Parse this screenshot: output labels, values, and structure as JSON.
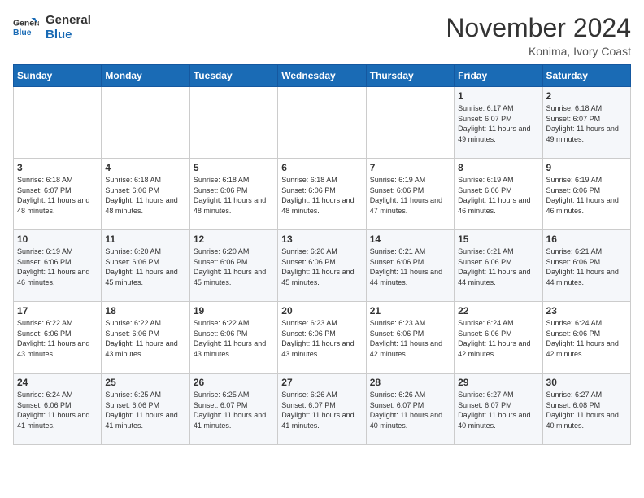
{
  "header": {
    "logo_line1": "General",
    "logo_line2": "Blue",
    "month_title": "November 2024",
    "location": "Konima, Ivory Coast"
  },
  "weekdays": [
    "Sunday",
    "Monday",
    "Tuesday",
    "Wednesday",
    "Thursday",
    "Friday",
    "Saturday"
  ],
  "weeks": [
    [
      {
        "day": "",
        "info": ""
      },
      {
        "day": "",
        "info": ""
      },
      {
        "day": "",
        "info": ""
      },
      {
        "day": "",
        "info": ""
      },
      {
        "day": "",
        "info": ""
      },
      {
        "day": "1",
        "info": "Sunrise: 6:17 AM\nSunset: 6:07 PM\nDaylight: 11 hours and 49 minutes."
      },
      {
        "day": "2",
        "info": "Sunrise: 6:18 AM\nSunset: 6:07 PM\nDaylight: 11 hours and 49 minutes."
      }
    ],
    [
      {
        "day": "3",
        "info": "Sunrise: 6:18 AM\nSunset: 6:07 PM\nDaylight: 11 hours and 48 minutes."
      },
      {
        "day": "4",
        "info": "Sunrise: 6:18 AM\nSunset: 6:06 PM\nDaylight: 11 hours and 48 minutes."
      },
      {
        "day": "5",
        "info": "Sunrise: 6:18 AM\nSunset: 6:06 PM\nDaylight: 11 hours and 48 minutes."
      },
      {
        "day": "6",
        "info": "Sunrise: 6:18 AM\nSunset: 6:06 PM\nDaylight: 11 hours and 48 minutes."
      },
      {
        "day": "7",
        "info": "Sunrise: 6:19 AM\nSunset: 6:06 PM\nDaylight: 11 hours and 47 minutes."
      },
      {
        "day": "8",
        "info": "Sunrise: 6:19 AM\nSunset: 6:06 PM\nDaylight: 11 hours and 46 minutes."
      },
      {
        "day": "9",
        "info": "Sunrise: 6:19 AM\nSunset: 6:06 PM\nDaylight: 11 hours and 46 minutes."
      }
    ],
    [
      {
        "day": "10",
        "info": "Sunrise: 6:19 AM\nSunset: 6:06 PM\nDaylight: 11 hours and 46 minutes."
      },
      {
        "day": "11",
        "info": "Sunrise: 6:20 AM\nSunset: 6:06 PM\nDaylight: 11 hours and 45 minutes."
      },
      {
        "day": "12",
        "info": "Sunrise: 6:20 AM\nSunset: 6:06 PM\nDaylight: 11 hours and 45 minutes."
      },
      {
        "day": "13",
        "info": "Sunrise: 6:20 AM\nSunset: 6:06 PM\nDaylight: 11 hours and 45 minutes."
      },
      {
        "day": "14",
        "info": "Sunrise: 6:21 AM\nSunset: 6:06 PM\nDaylight: 11 hours and 44 minutes."
      },
      {
        "day": "15",
        "info": "Sunrise: 6:21 AM\nSunset: 6:06 PM\nDaylight: 11 hours and 44 minutes."
      },
      {
        "day": "16",
        "info": "Sunrise: 6:21 AM\nSunset: 6:06 PM\nDaylight: 11 hours and 44 minutes."
      }
    ],
    [
      {
        "day": "17",
        "info": "Sunrise: 6:22 AM\nSunset: 6:06 PM\nDaylight: 11 hours and 43 minutes."
      },
      {
        "day": "18",
        "info": "Sunrise: 6:22 AM\nSunset: 6:06 PM\nDaylight: 11 hours and 43 minutes."
      },
      {
        "day": "19",
        "info": "Sunrise: 6:22 AM\nSunset: 6:06 PM\nDaylight: 11 hours and 43 minutes."
      },
      {
        "day": "20",
        "info": "Sunrise: 6:23 AM\nSunset: 6:06 PM\nDaylight: 11 hours and 43 minutes."
      },
      {
        "day": "21",
        "info": "Sunrise: 6:23 AM\nSunset: 6:06 PM\nDaylight: 11 hours and 42 minutes."
      },
      {
        "day": "22",
        "info": "Sunrise: 6:24 AM\nSunset: 6:06 PM\nDaylight: 11 hours and 42 minutes."
      },
      {
        "day": "23",
        "info": "Sunrise: 6:24 AM\nSunset: 6:06 PM\nDaylight: 11 hours and 42 minutes."
      }
    ],
    [
      {
        "day": "24",
        "info": "Sunrise: 6:24 AM\nSunset: 6:06 PM\nDaylight: 11 hours and 41 minutes."
      },
      {
        "day": "25",
        "info": "Sunrise: 6:25 AM\nSunset: 6:06 PM\nDaylight: 11 hours and 41 minutes."
      },
      {
        "day": "26",
        "info": "Sunrise: 6:25 AM\nSunset: 6:07 PM\nDaylight: 11 hours and 41 minutes."
      },
      {
        "day": "27",
        "info": "Sunrise: 6:26 AM\nSunset: 6:07 PM\nDaylight: 11 hours and 41 minutes."
      },
      {
        "day": "28",
        "info": "Sunrise: 6:26 AM\nSunset: 6:07 PM\nDaylight: 11 hours and 40 minutes."
      },
      {
        "day": "29",
        "info": "Sunrise: 6:27 AM\nSunset: 6:07 PM\nDaylight: 11 hours and 40 minutes."
      },
      {
        "day": "30",
        "info": "Sunrise: 6:27 AM\nSunset: 6:08 PM\nDaylight: 11 hours and 40 minutes."
      }
    ]
  ]
}
